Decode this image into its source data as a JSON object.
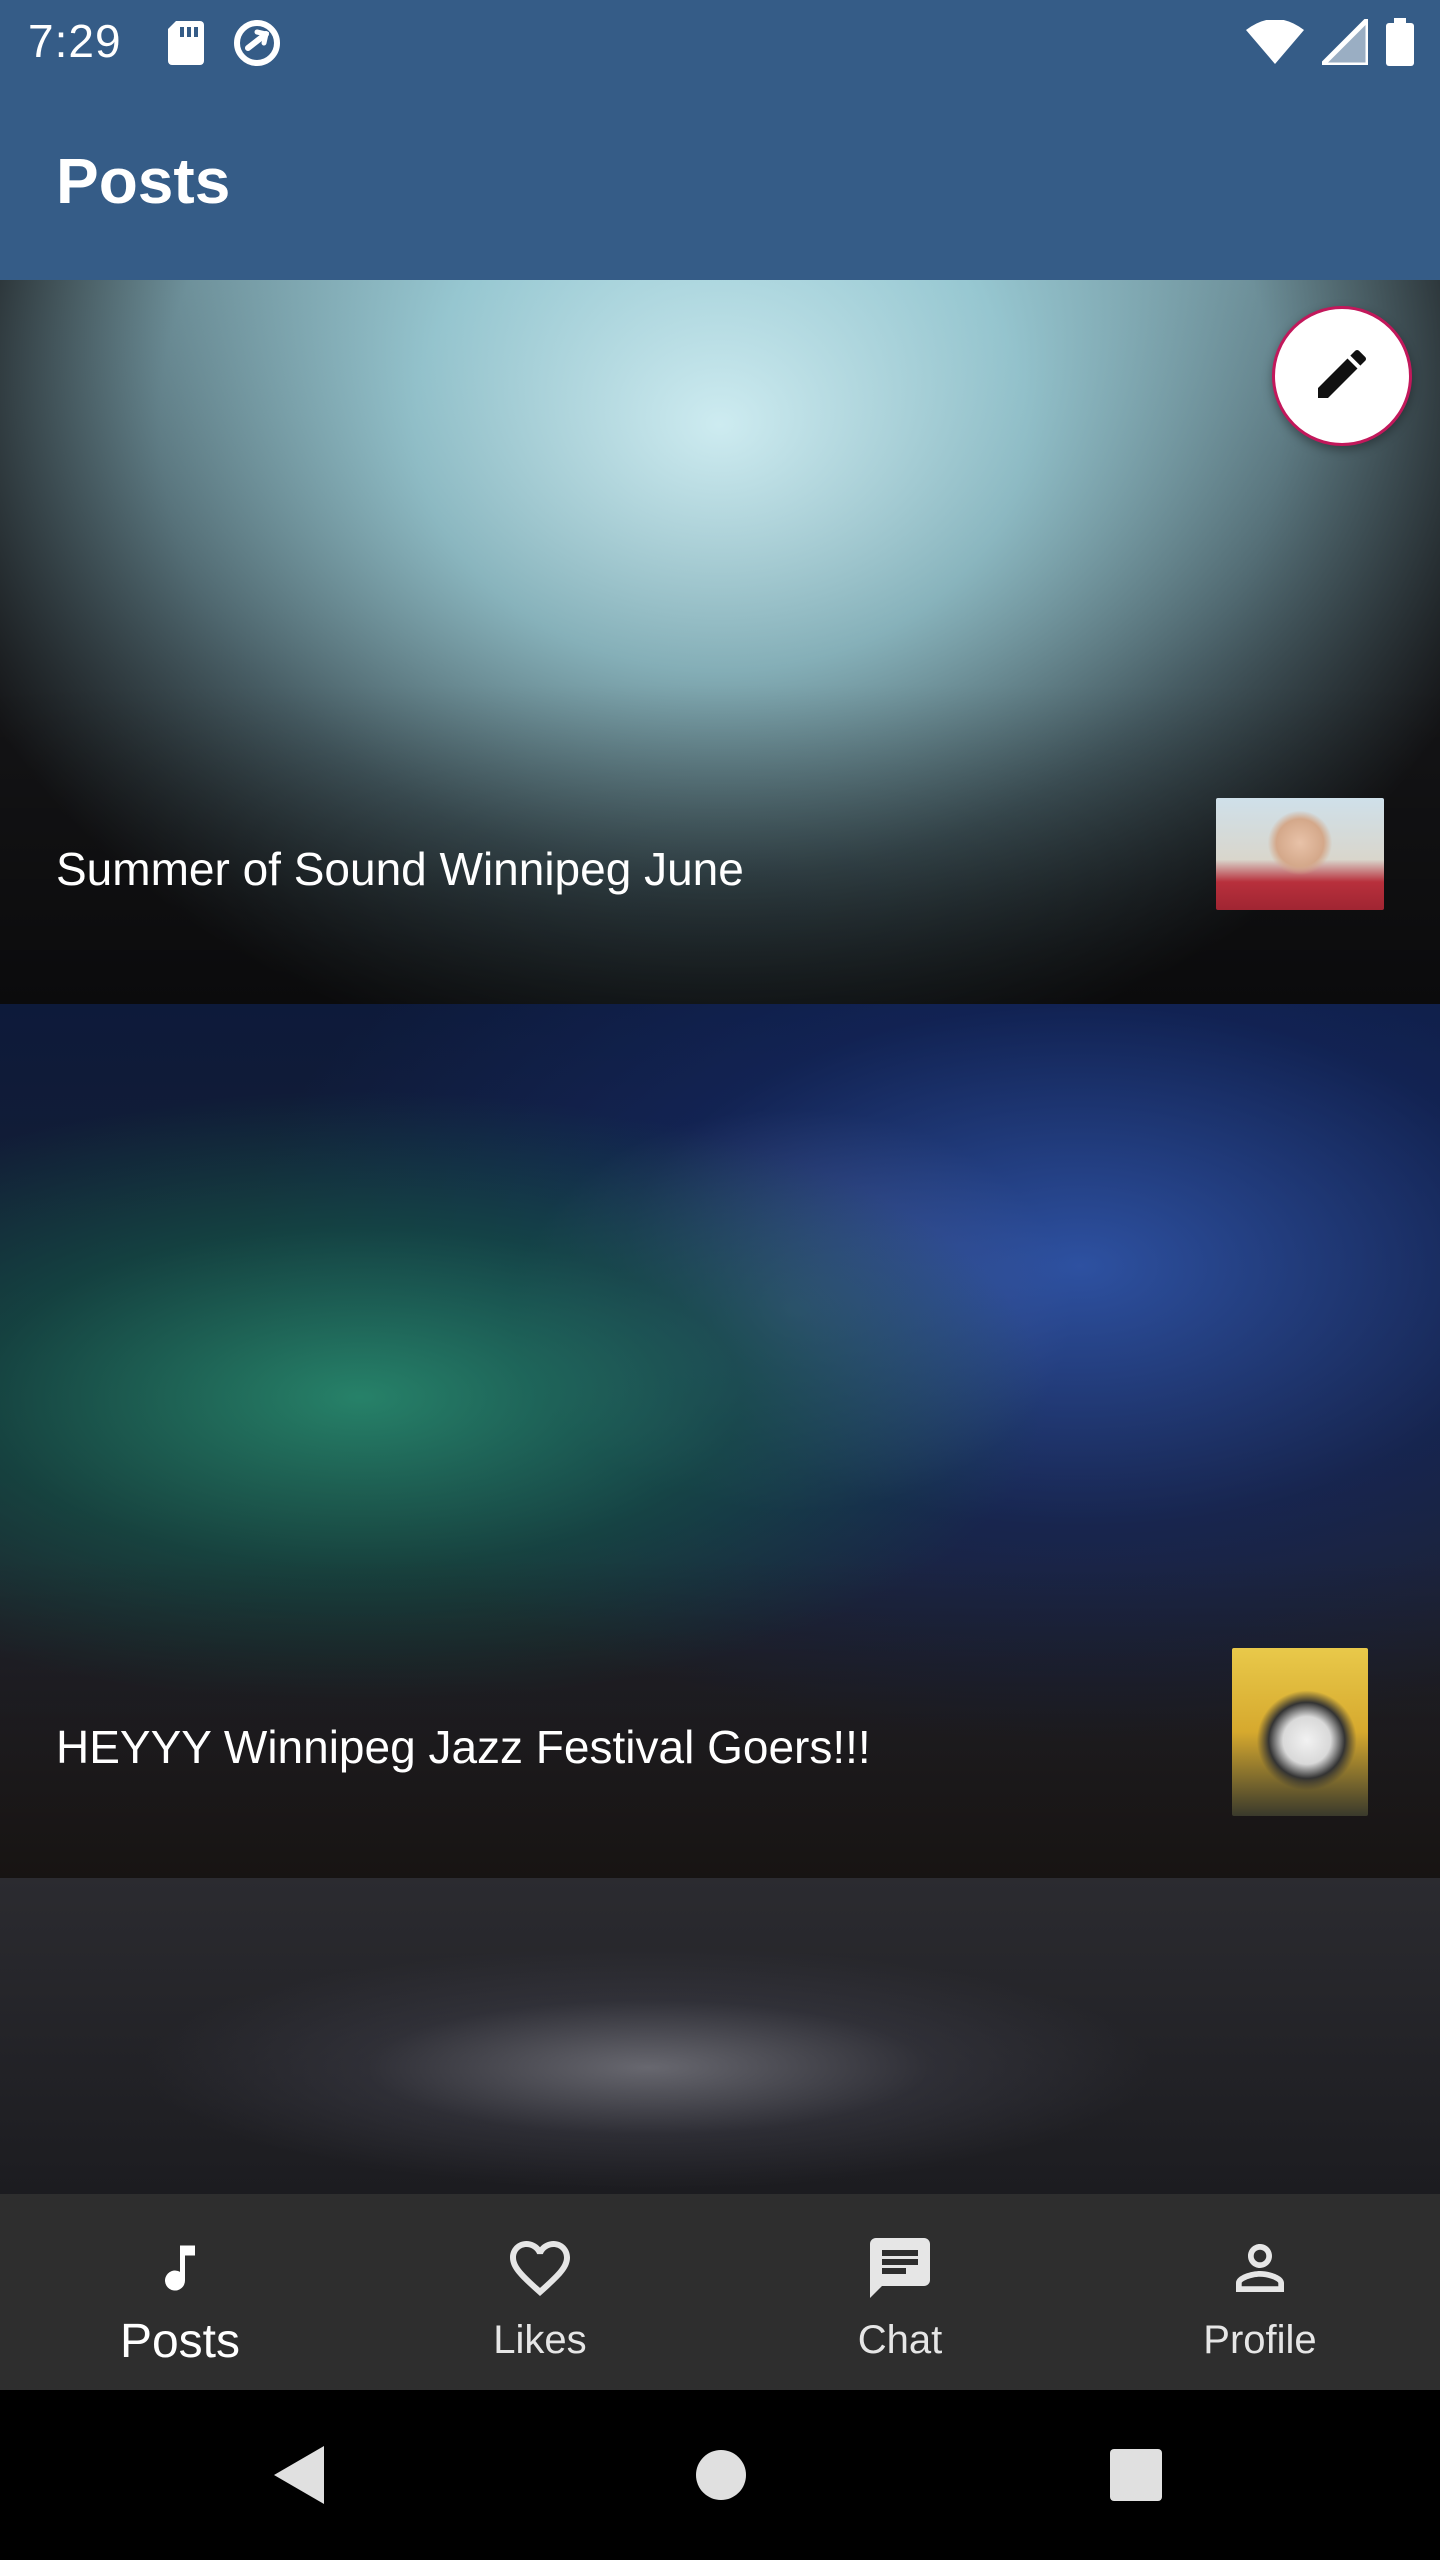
{
  "status_bar": {
    "time": "7:29",
    "left_icons": [
      "sd-card-icon",
      "sync-icon"
    ],
    "right_icons": [
      "wifi-icon",
      "cell-signal-icon",
      "battery-icon"
    ]
  },
  "app_bar": {
    "title": "Posts"
  },
  "posts": [
    {
      "title": "Summer of Sound Winnipeg June",
      "image": "concert-crowd-photo",
      "avatar": "user-avatar-woman-hat"
    },
    {
      "title": "HEYYY Winnipeg Jazz Festival Goers!!!",
      "image": "jazz-festival-stage-photo",
      "avatar": "user-avatar-penguin"
    },
    {
      "title": "",
      "image": "dark-portrait-photo",
      "avatar": ""
    }
  ],
  "fab": {
    "icon": "pencil-icon"
  },
  "bottom_nav": {
    "items": [
      {
        "label": "Posts",
        "icon": "music-note-icon",
        "active": true
      },
      {
        "label": "Likes",
        "icon": "heart-icon",
        "active": false
      },
      {
        "label": "Chat",
        "icon": "chat-icon",
        "active": false
      },
      {
        "label": "Profile",
        "icon": "person-icon",
        "active": false
      }
    ]
  },
  "system_nav": [
    "back-icon",
    "home-icon",
    "recents-icon"
  ],
  "colors": {
    "primary": "#355C87",
    "fab_border": "#C2185B",
    "nav_background": "#2E2E2E"
  }
}
